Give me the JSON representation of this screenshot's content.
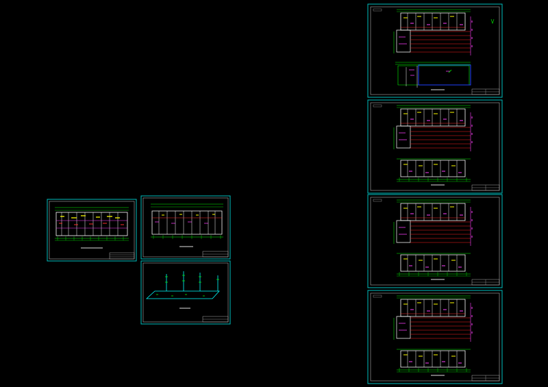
{
  "colors": {
    "background": "#000000",
    "sheet_border": "#00c0c0",
    "inner_frame": "#c8c8c8",
    "walls": "#ffffff",
    "dims": "#00ff00",
    "red_lines": "#ff2020",
    "magenta": "#ff40ff",
    "yellow": "#ffff00",
    "blue": "#2040ff",
    "cyan": "#00ffff"
  },
  "drawing": {
    "description_visible_text": "none legible",
    "sheets": [
      {
        "id": "sheet-left-plan",
        "kind": "floor-plan"
      },
      {
        "id": "sheet-middle-top-plan",
        "kind": "floor-plan"
      },
      {
        "id": "sheet-middle-bottom-riser",
        "kind": "pipe-riser-diagram"
      },
      {
        "id": "sheet-right-1",
        "kind": "site-plan"
      },
      {
        "id": "sheet-right-2",
        "kind": "site-plan"
      },
      {
        "id": "sheet-right-3",
        "kind": "site-plan"
      },
      {
        "id": "sheet-right-4",
        "kind": "site-plan"
      }
    ]
  }
}
